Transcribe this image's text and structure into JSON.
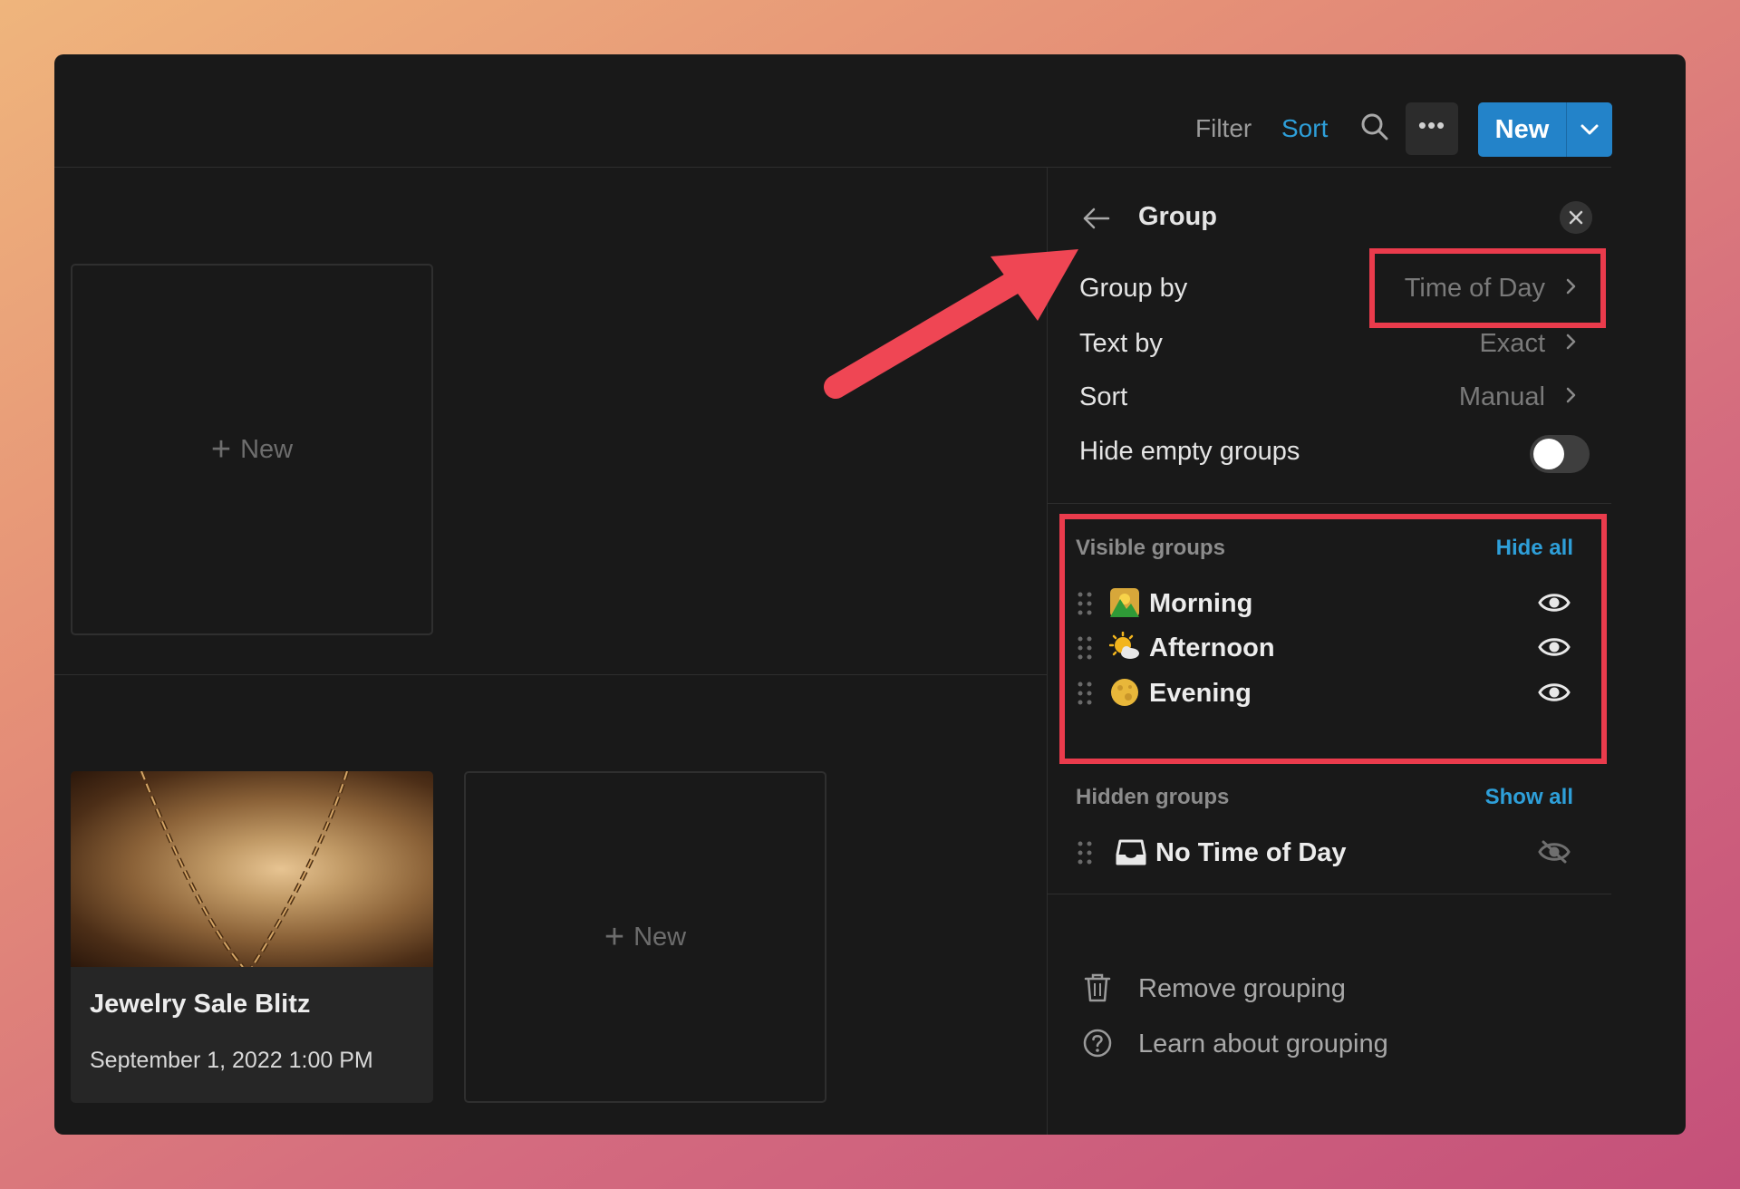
{
  "toolbar": {
    "filter_label": "Filter",
    "sort_label": "Sort",
    "more_label": "•••",
    "new_label": "New",
    "accent_color": "#2383c9"
  },
  "board": {
    "new_card_label": "New",
    "card": {
      "title": "Jewelry Sale Blitz",
      "date": "September 1, 2022 1:00 PM"
    }
  },
  "panel": {
    "title": "Group",
    "settings": [
      {
        "label": "Group by",
        "value": "Time of Day"
      },
      {
        "label": "Text by",
        "value": "Exact"
      },
      {
        "label": "Sort",
        "value": "Manual"
      }
    ],
    "hide_empty_label": "Hide empty groups",
    "hide_empty_on": false,
    "visible": {
      "heading": "Visible groups",
      "action": "Hide all",
      "groups": [
        {
          "name": "Morning",
          "icon": "sunrise-icon"
        },
        {
          "name": "Afternoon",
          "icon": "sun-behind-cloud-icon"
        },
        {
          "name": "Evening",
          "icon": "moon-icon"
        }
      ]
    },
    "hidden": {
      "heading": "Hidden groups",
      "action": "Show all",
      "groups": [
        {
          "name": "No Time of Day",
          "icon": "inbox-icon"
        }
      ]
    },
    "footer": {
      "remove_label": "Remove grouping",
      "learn_label": "Learn about grouping"
    }
  },
  "annotation_color": "#ea3b4c"
}
